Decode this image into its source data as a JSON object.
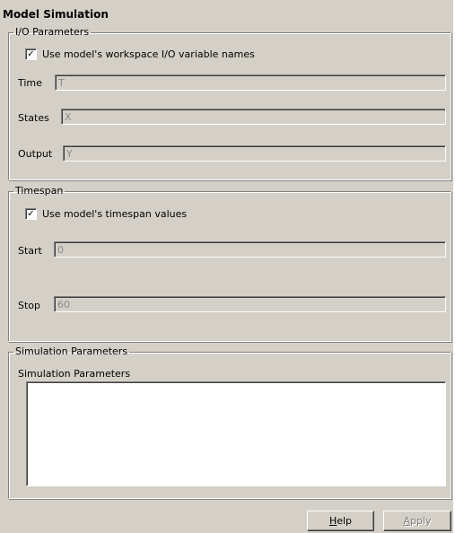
{
  "panel": {
    "title": "Model Simulation"
  },
  "io_parameters": {
    "legend": "I/O Parameters",
    "use_workspace_names": {
      "checked": true,
      "mark": "✓",
      "label": "Use model's workspace I/O variable names"
    },
    "time": {
      "label": "Time",
      "value": "T"
    },
    "states": {
      "label": "States",
      "value": "X"
    },
    "output": {
      "label": "Output",
      "value": "Y"
    }
  },
  "timespan": {
    "legend": "Timespan",
    "use_timespan": {
      "checked": true,
      "mark": "✓",
      "label": "Use model's timespan values"
    },
    "start": {
      "label": "Start",
      "value": "0"
    },
    "stop": {
      "label": "Stop",
      "value": "60"
    }
  },
  "simulation_parameters": {
    "legend": "Simulation Parameters",
    "label": "Simulation Parameters",
    "value": ""
  },
  "buttons": {
    "help": {
      "mnemonic": "H",
      "rest": "elp"
    },
    "apply": {
      "mnemonic": "A",
      "rest": "pply",
      "enabled": false
    }
  }
}
